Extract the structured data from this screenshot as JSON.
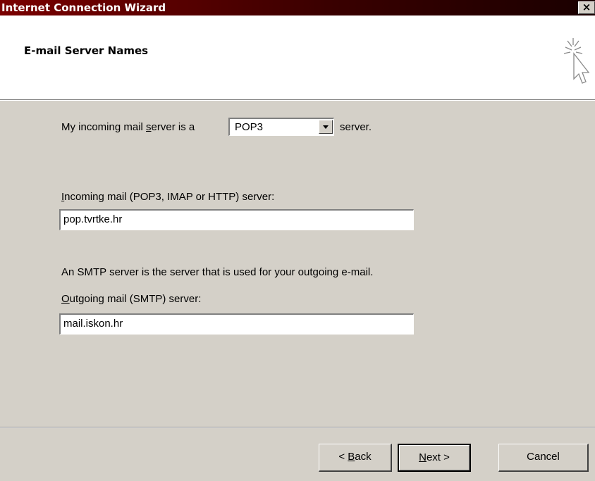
{
  "window": {
    "title": "Internet Connection Wizard",
    "close_glyph": "×"
  },
  "header": {
    "title": "E-mail Server Names",
    "icon": "wizard-cursor-icon"
  },
  "incoming_type": {
    "prefix": "My incoming mail ",
    "prefix_accel": "s",
    "prefix_rest": "erver is a",
    "selected": "POP3",
    "suffix": "server."
  },
  "incoming_server": {
    "label_accel": "I",
    "label_rest": "ncoming mail (POP3, IMAP or HTTP) server:",
    "value": "pop.tvrtke.hr"
  },
  "smtp_info": "An SMTP server is the server that is used for your outgoing e-mail.",
  "outgoing_server": {
    "label_accel": "O",
    "label_rest": "utgoing mail (SMTP) server:",
    "value": "mail.iskon.hr"
  },
  "buttons": {
    "back_prefix": "< ",
    "back_accel": "B",
    "back_rest": "ack",
    "next_accel": "N",
    "next_rest": "ext >",
    "cancel": "Cancel"
  }
}
